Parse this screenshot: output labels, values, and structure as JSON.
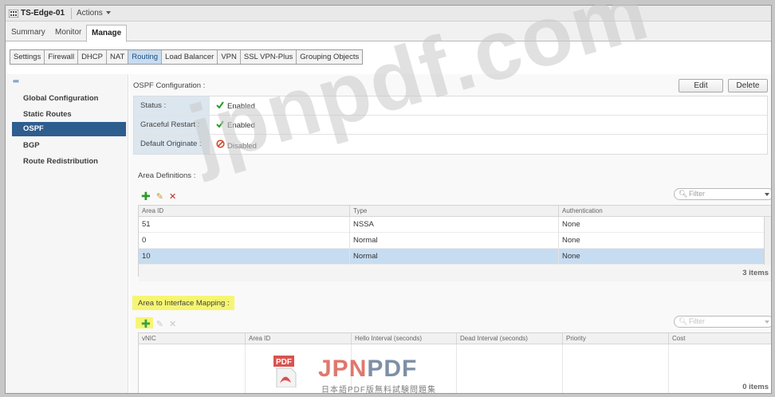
{
  "header": {
    "edge_name": "TS-Edge-01",
    "actions_label": "Actions"
  },
  "top_tabs": [
    {
      "label": "Summary",
      "active": false
    },
    {
      "label": "Monitor",
      "active": false
    },
    {
      "label": "Manage",
      "active": true
    }
  ],
  "sub_tabs": [
    {
      "label": "Settings",
      "active": false
    },
    {
      "label": "Firewall",
      "active": false
    },
    {
      "label": "DHCP",
      "active": false
    },
    {
      "label": "NAT",
      "active": false
    },
    {
      "label": "Routing",
      "active": true
    },
    {
      "label": "Load Balancer",
      "active": false
    },
    {
      "label": "VPN",
      "active": false
    },
    {
      "label": "SSL VPN-Plus",
      "active": false
    },
    {
      "label": "Grouping Objects",
      "active": false
    }
  ],
  "sidebar": {
    "collapse_glyph": "««",
    "items": [
      {
        "label": "Global Configuration",
        "active": false
      },
      {
        "label": "Static Routes",
        "active": false
      },
      {
        "label": "OSPF",
        "active": true
      },
      {
        "label": "BGP",
        "active": false
      },
      {
        "label": "Route Redistribution",
        "active": false
      }
    ]
  },
  "ospf": {
    "title": "OSPF Configuration :",
    "edit_label": "Edit",
    "delete_label": "Delete",
    "rows": [
      {
        "label": "Status :",
        "value": "Enabled",
        "state": "enabled"
      },
      {
        "label": "Graceful Restart :",
        "value": "Enabled",
        "state": "enabled"
      },
      {
        "label": "Default Originate :",
        "value": "Disabled",
        "state": "disabled"
      }
    ]
  },
  "area_definitions": {
    "title": "Area Definitions :",
    "filter_placeholder": "Filter",
    "columns": [
      "Area ID",
      "Type",
      "Authentication"
    ],
    "rows": [
      {
        "area_id": "51",
        "type": "NSSA",
        "authentication": "None",
        "selected": false
      },
      {
        "area_id": "0",
        "type": "Normal",
        "authentication": "None",
        "selected": false
      },
      {
        "area_id": "10",
        "type": "Normal",
        "authentication": "None",
        "selected": true
      }
    ],
    "count_label": "3 items"
  },
  "area_interface_mapping": {
    "title": "Area to Interface Mapping :",
    "filter_placeholder": "Filter",
    "columns": [
      "vNIC",
      "Area ID",
      "Hello Interval (seconds)",
      "Dead Interval (seconds)",
      "Priority",
      "Cost"
    ],
    "count_label": "0 items"
  },
  "watermark": {
    "text": "jpnpdf.com",
    "logo_badge": "PDF",
    "logo_part1": "JPN",
    "logo_part2": "PDF",
    "logo_subtitle": "日本語PDF版無料試験問題集"
  },
  "colors": {
    "selected_side": "#2e5d8f",
    "selected_row": "#c6dcf1",
    "label_bg": "#dce6ef",
    "enabled_check": "#2a9a2a",
    "disabled_icon": "#d04a2d",
    "highlight": "#f6f45a"
  }
}
